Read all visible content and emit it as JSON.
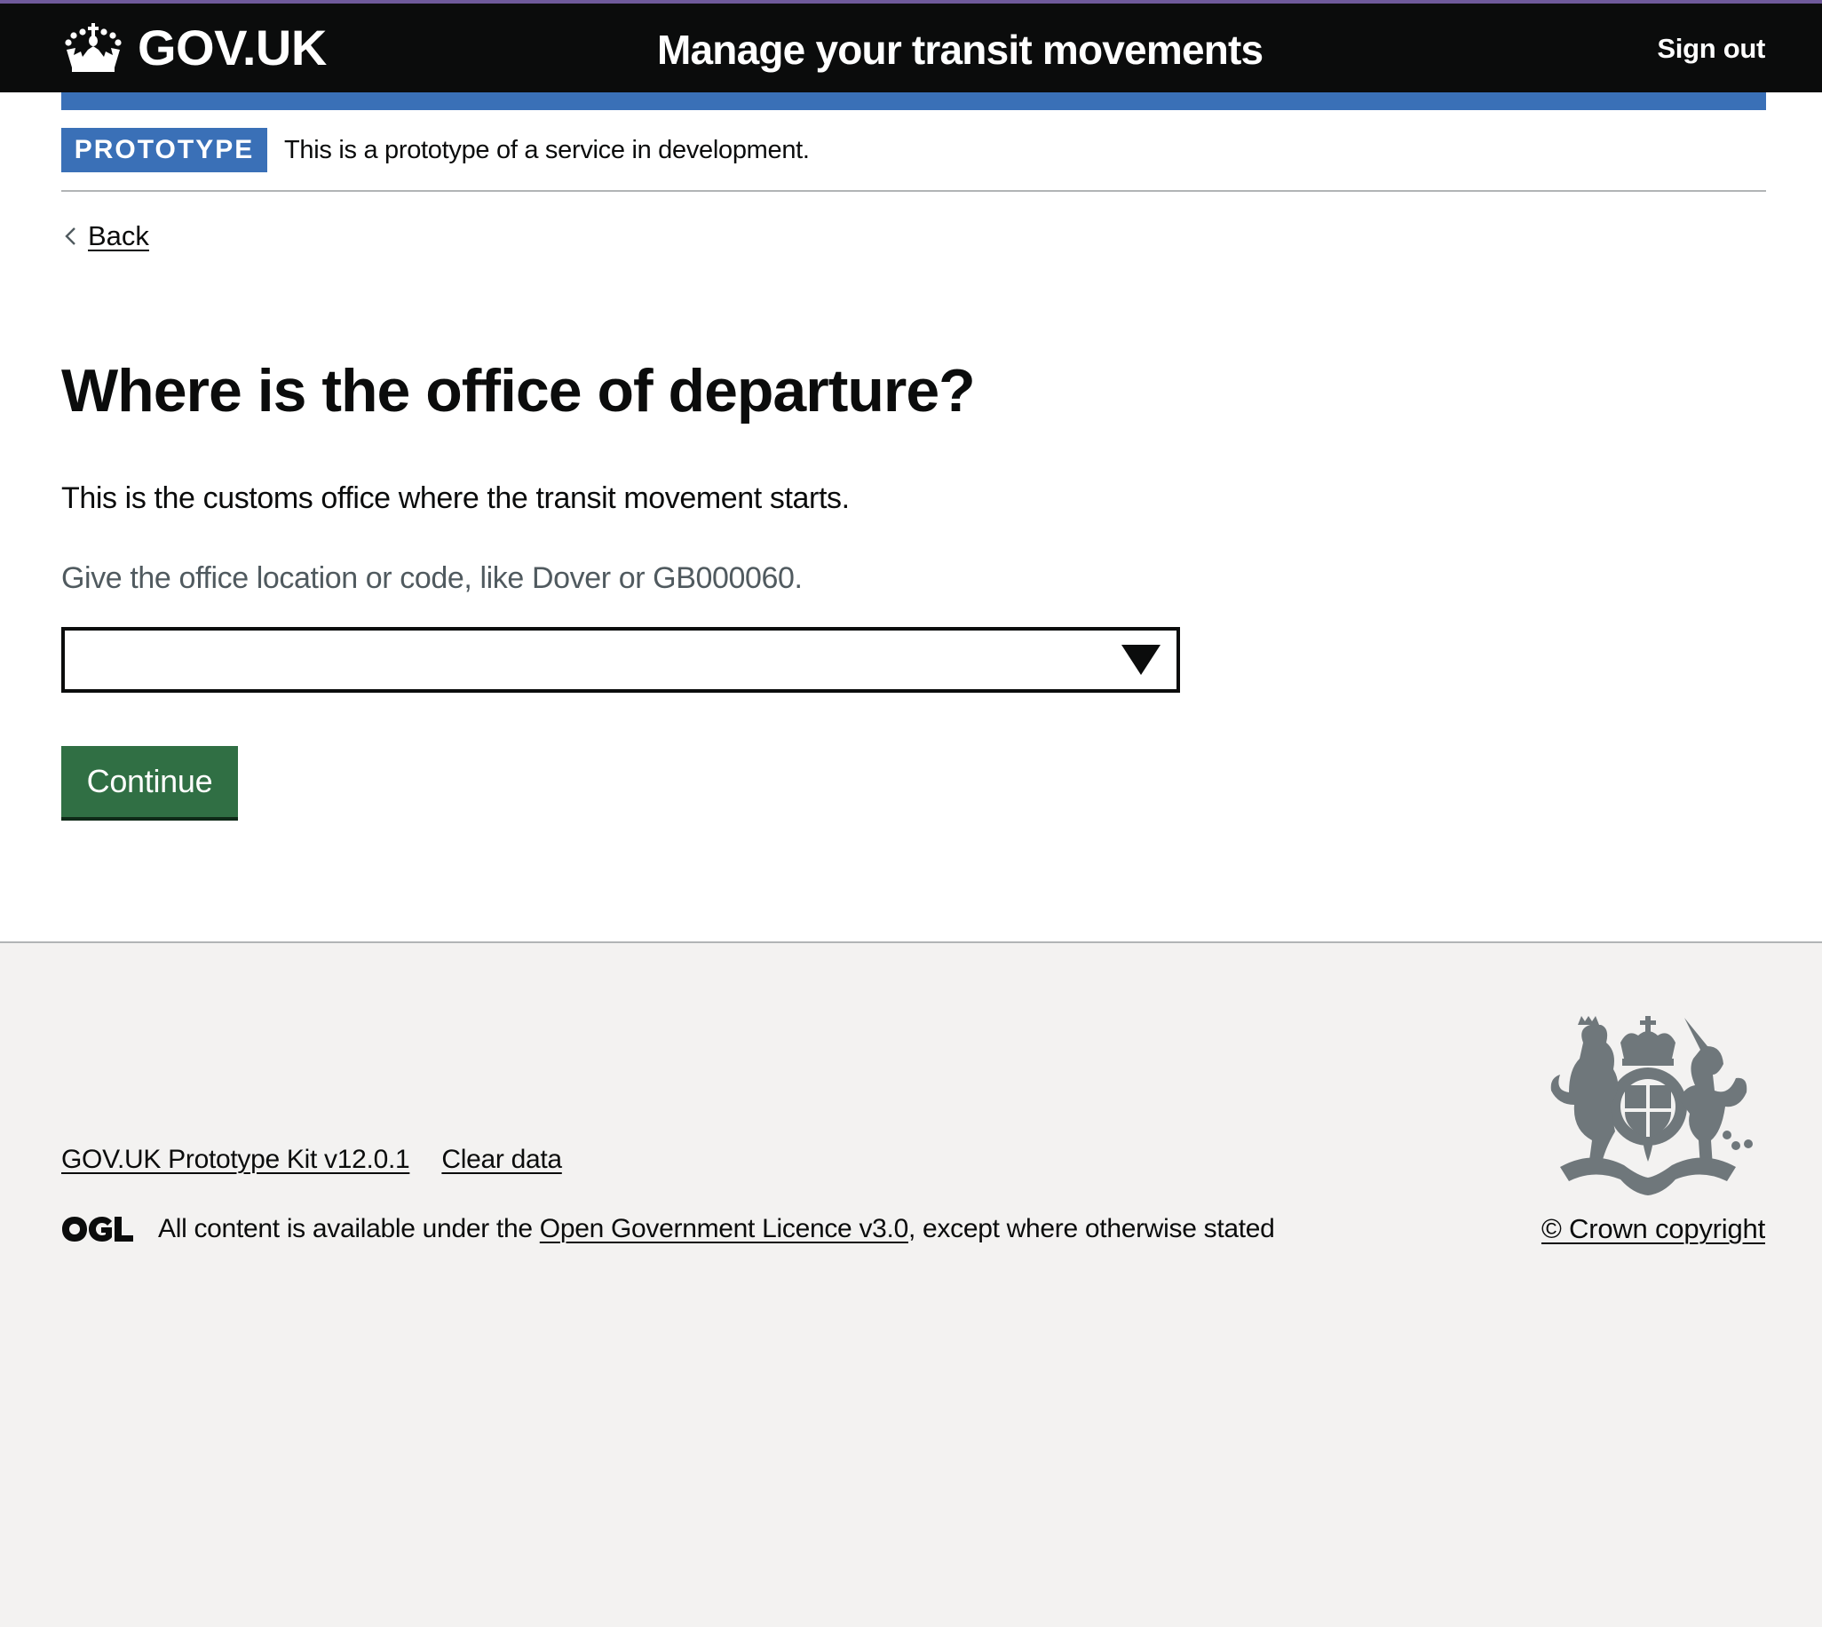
{
  "header": {
    "logo_text": "GOV.UK",
    "logo_icon": "crown-icon",
    "service_name": "Manage your transit movements",
    "sign_out_label": "Sign out"
  },
  "phase_banner": {
    "tag": "PROTOTYPE",
    "text": "This is a prototype of a service in development."
  },
  "back_link": {
    "label": "Back",
    "icon": "chevron-left-icon"
  },
  "main": {
    "heading": "Where is the office of departure?",
    "body": "This is the customs office where the transit movement starts.",
    "hint": "Give the office location or code, like Dover or GB000060.",
    "office_select": {
      "value": "",
      "icon": "dropdown-triangle-icon"
    },
    "continue_label": "Continue"
  },
  "footer": {
    "links": [
      {
        "label": "GOV.UK Prototype Kit v12.0.1"
      },
      {
        "label": "Clear data"
      }
    ],
    "ogl_icon": "ogl-logo-icon",
    "licence_prefix": "All content is available under the ",
    "licence_link": "Open Government Licence v3.0",
    "licence_suffix": ", except where otherwise stated",
    "crest_icon": "royal-coat-of-arms-icon",
    "copyright_label": "© Crown copyright"
  },
  "colors": {
    "header_bg": "#0b0c0c",
    "top_line": "#6f5a9b",
    "brand_blue": "#3a70b7",
    "button_green": "#306f44",
    "footer_bg": "#f3f2f1",
    "hint_grey": "#505a5f",
    "crest_grey": "#6f777b"
  }
}
